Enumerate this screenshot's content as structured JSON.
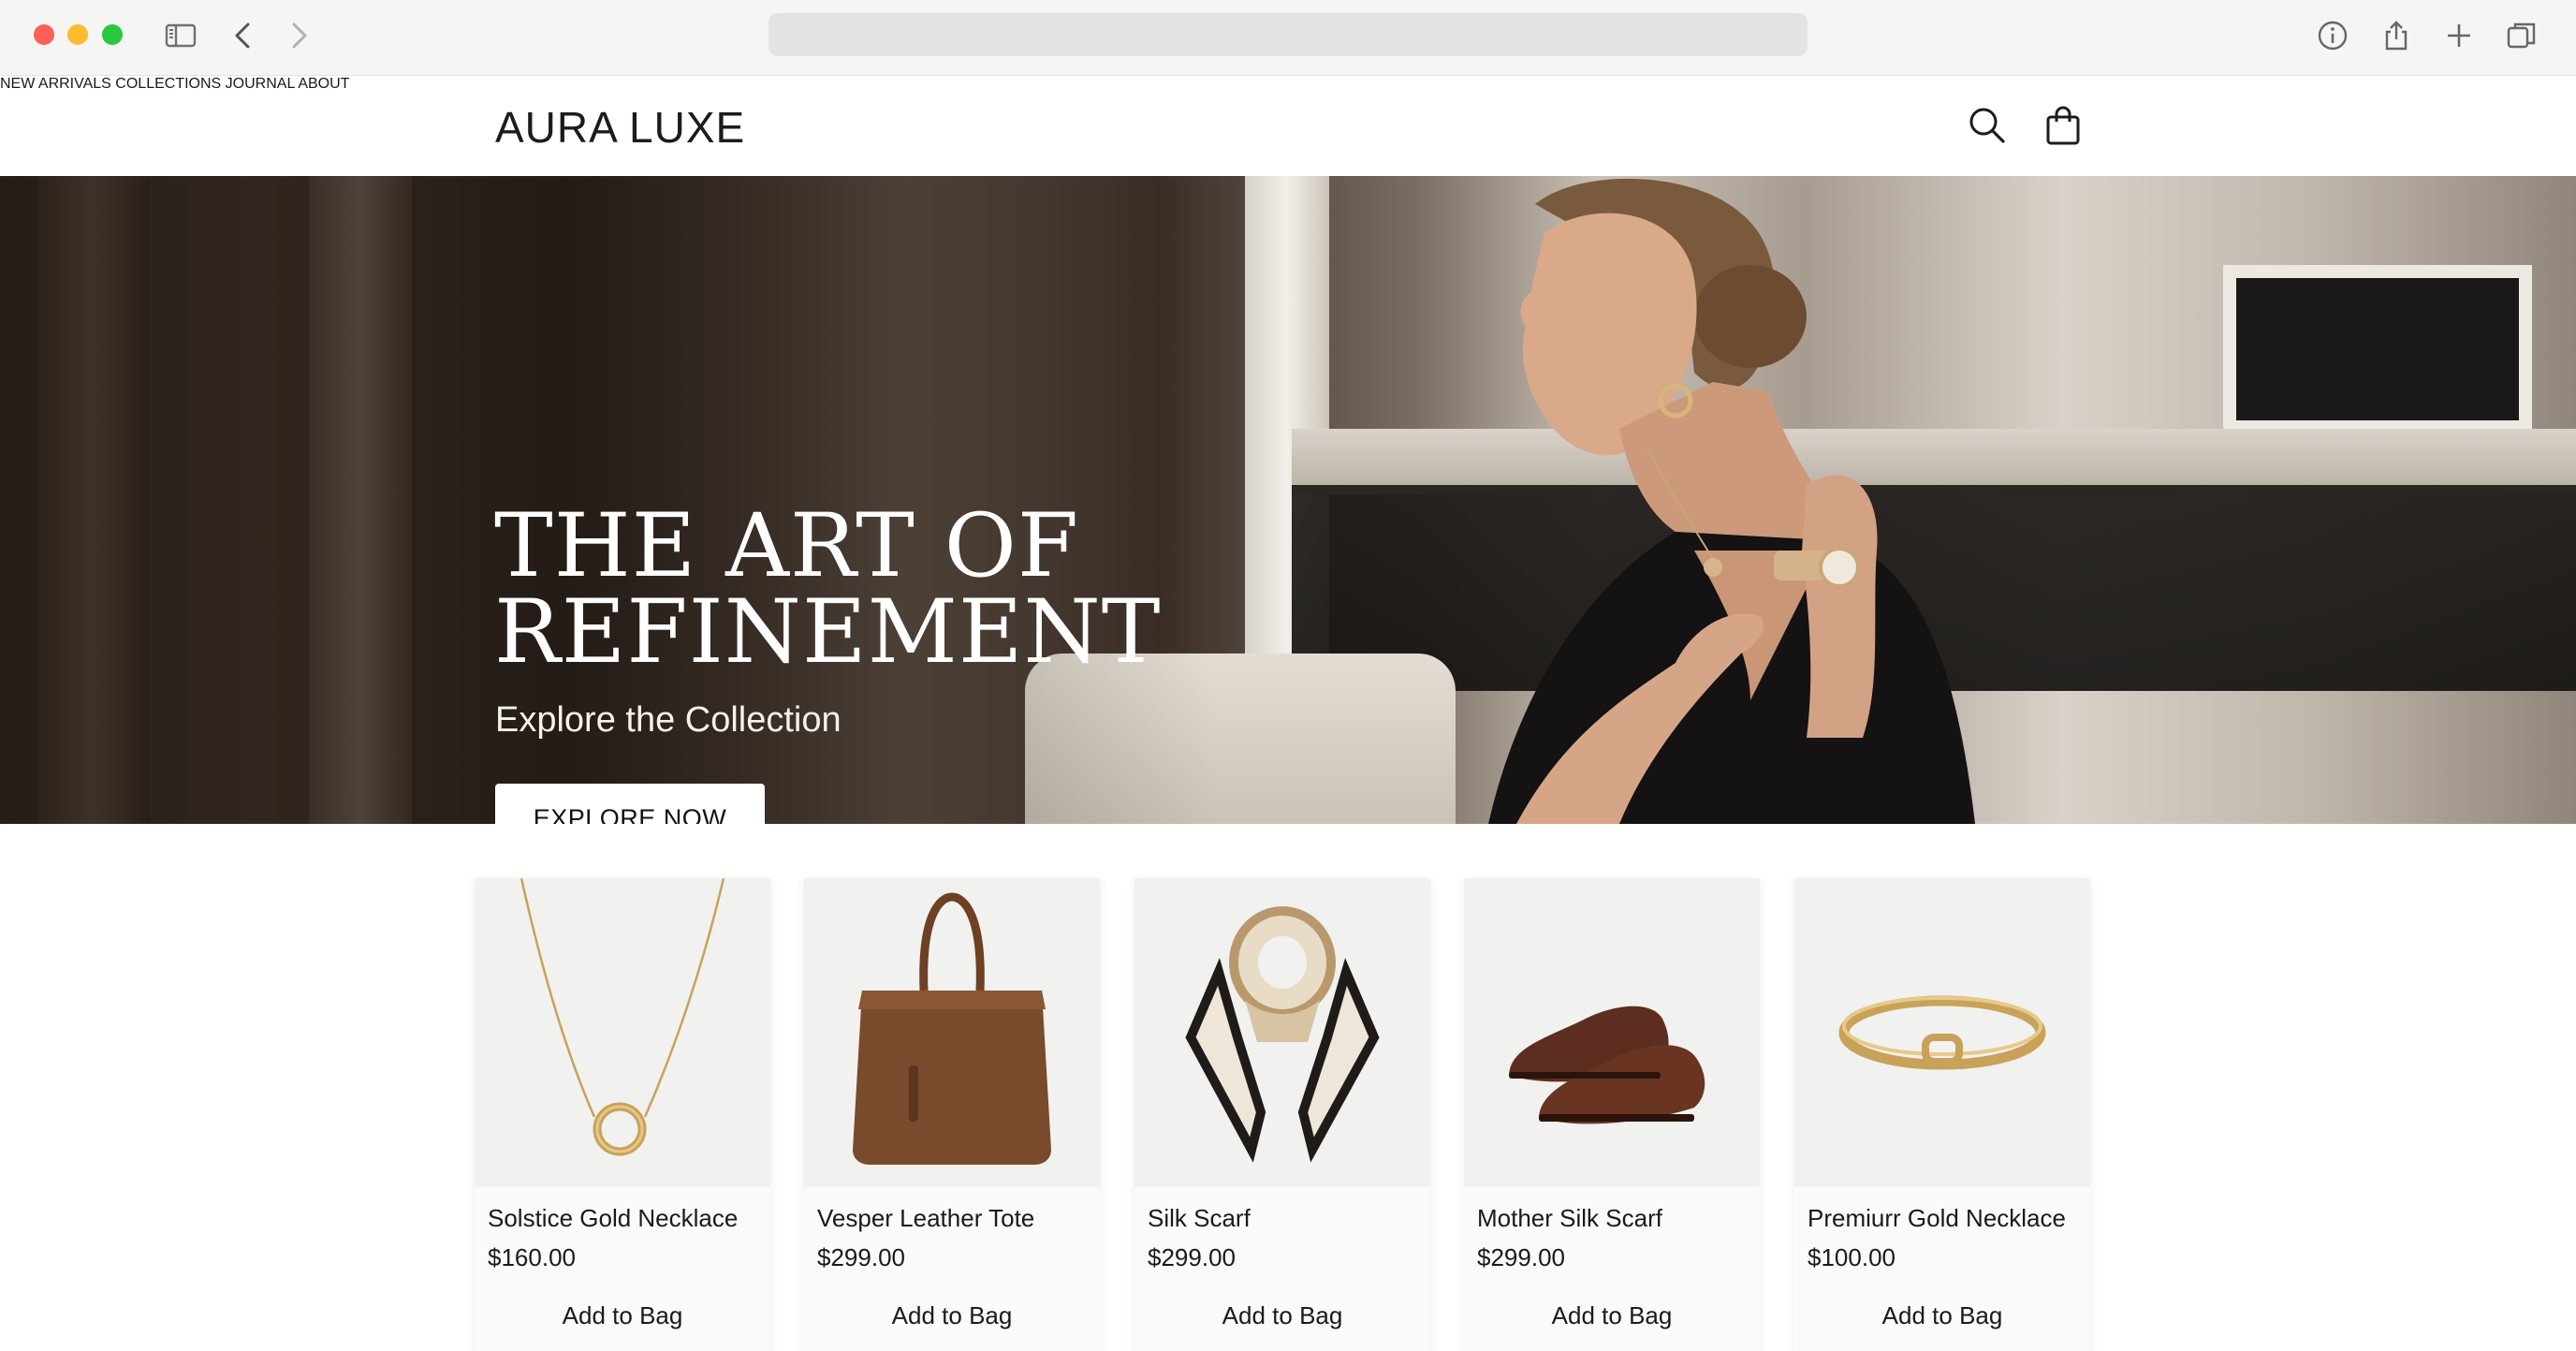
{
  "browser": {
    "icons": [
      "sidebar-icon",
      "back-icon",
      "forward-icon",
      "info-icon",
      "share-icon",
      "new-tab-icon",
      "tabs-overview-icon"
    ],
    "address": ""
  },
  "header": {
    "logo": "AURA LUXE",
    "nav": [
      "NEW ARRIVALS",
      "COLLECTIONS",
      "JOURNAL",
      "ABOUT"
    ],
    "icons": [
      "search-icon",
      "shopping-bag-icon"
    ]
  },
  "hero": {
    "title_line1": "THE ART OF",
    "title_line2": "REFINEMENT",
    "subtitle": "Explore the Collection",
    "button": "EXPLORE NOW"
  },
  "products": [
    {
      "name": "Solstice Gold Necklace",
      "price": "$160.00",
      "action": "Add to Bag",
      "image": "gold-circle-necklace"
    },
    {
      "name": "Vesper Leather Tote",
      "price": "$299.00",
      "action": "Add to Bag",
      "image": "brown-leather-tote"
    },
    {
      "name": "Silk Scarf",
      "price": "$299.00",
      "action": "Add to Bag",
      "image": "silk-scarf"
    },
    {
      "name": "Mother Silk Scarf",
      "price": "$299.00",
      "action": "Add to Bag",
      "image": "brown-oxford-shoes"
    },
    {
      "name": "Premiurr Gold Necklace",
      "price": "$100.00",
      "action": "Add to Bag",
      "image": "gold-cuff-bracelet"
    }
  ],
  "colors": {
    "chrome_bg": "#f5f5f4",
    "accent_gold": "#c9a25a",
    "leather_brown": "#7a4a2c",
    "text": "#1a1a1a"
  }
}
